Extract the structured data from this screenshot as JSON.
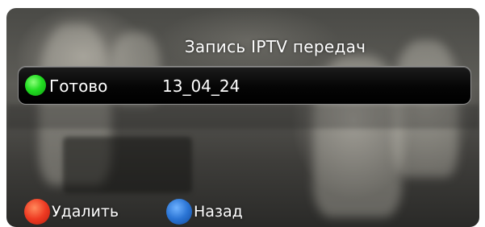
{
  "dialog": {
    "title": "Запись IPTV передач"
  },
  "recordings": [
    {
      "status": "Готово",
      "status_color": "#22dd22",
      "name": "13_04_24"
    }
  ],
  "buttons": {
    "delete_label": "Удалить",
    "delete_color": "#ee3a22",
    "back_label": "Назад",
    "back_color": "#2a74d4"
  }
}
